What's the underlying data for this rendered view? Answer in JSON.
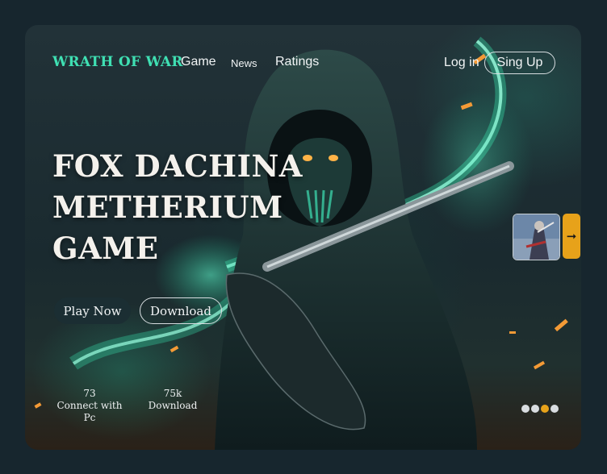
{
  "header": {
    "logo": "WRATH OF WAR",
    "nav": [
      {
        "label": "Game"
      },
      {
        "label": "News"
      },
      {
        "label": "Ratings"
      }
    ],
    "login_label": "Log in",
    "signup_label": "Sing Up"
  },
  "hero": {
    "headline_lines": [
      "FOX DACHINA",
      "METHERIUM",
      "GAME"
    ],
    "play_label": "Play Now",
    "download_label": "Download"
  },
  "stats": [
    {
      "value": "73",
      "label": "Connect with Pc"
    },
    {
      "value": "75k",
      "label": "Download"
    }
  ],
  "carousel": {
    "next_icon": "arrow-right-icon",
    "next_glyph": "➞",
    "dots": [
      {
        "color": "#d9dde0",
        "active": false
      },
      {
        "color": "#d9dde0",
        "active": false
      },
      {
        "color": "#e7a21a",
        "active": true
      },
      {
        "color": "#d9dde0",
        "active": false
      }
    ]
  },
  "colors": {
    "accent": "#3fe0b3",
    "orange": "#e7a21a",
    "background": "#17262e"
  }
}
